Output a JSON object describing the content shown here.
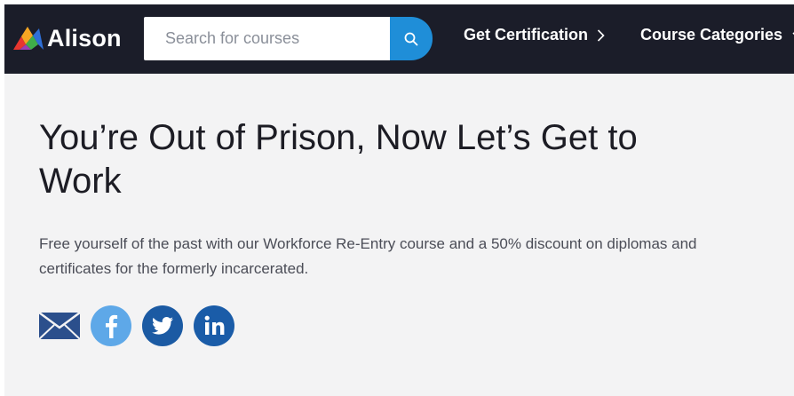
{
  "header": {
    "logo_text": "Alison",
    "search": {
      "placeholder": "Search for courses",
      "value": ""
    },
    "nav": [
      {
        "label": "Get Certification"
      },
      {
        "label": "Course Categories"
      }
    ]
  },
  "hero": {
    "title": "You’re Out of Prison, Now Let’s Get to Work",
    "subtitle": "Free yourself of the past with our Workforce Re-Entry course and a 50% discount on diplomas and certificates for the formerly incarcerated."
  },
  "share": [
    {
      "icon": "email-icon",
      "color": "#2b4f8c"
    },
    {
      "icon": "facebook-icon",
      "color": "#5ea8e8"
    },
    {
      "icon": "twitter-icon",
      "color": "#1b5aa3"
    },
    {
      "icon": "linkedin-icon",
      "color": "#1a5ca8"
    }
  ],
  "colors": {
    "navbar_bg": "#1b1d29",
    "search_button": "#1f8ed8",
    "page_bg": "#f3f3f4"
  }
}
